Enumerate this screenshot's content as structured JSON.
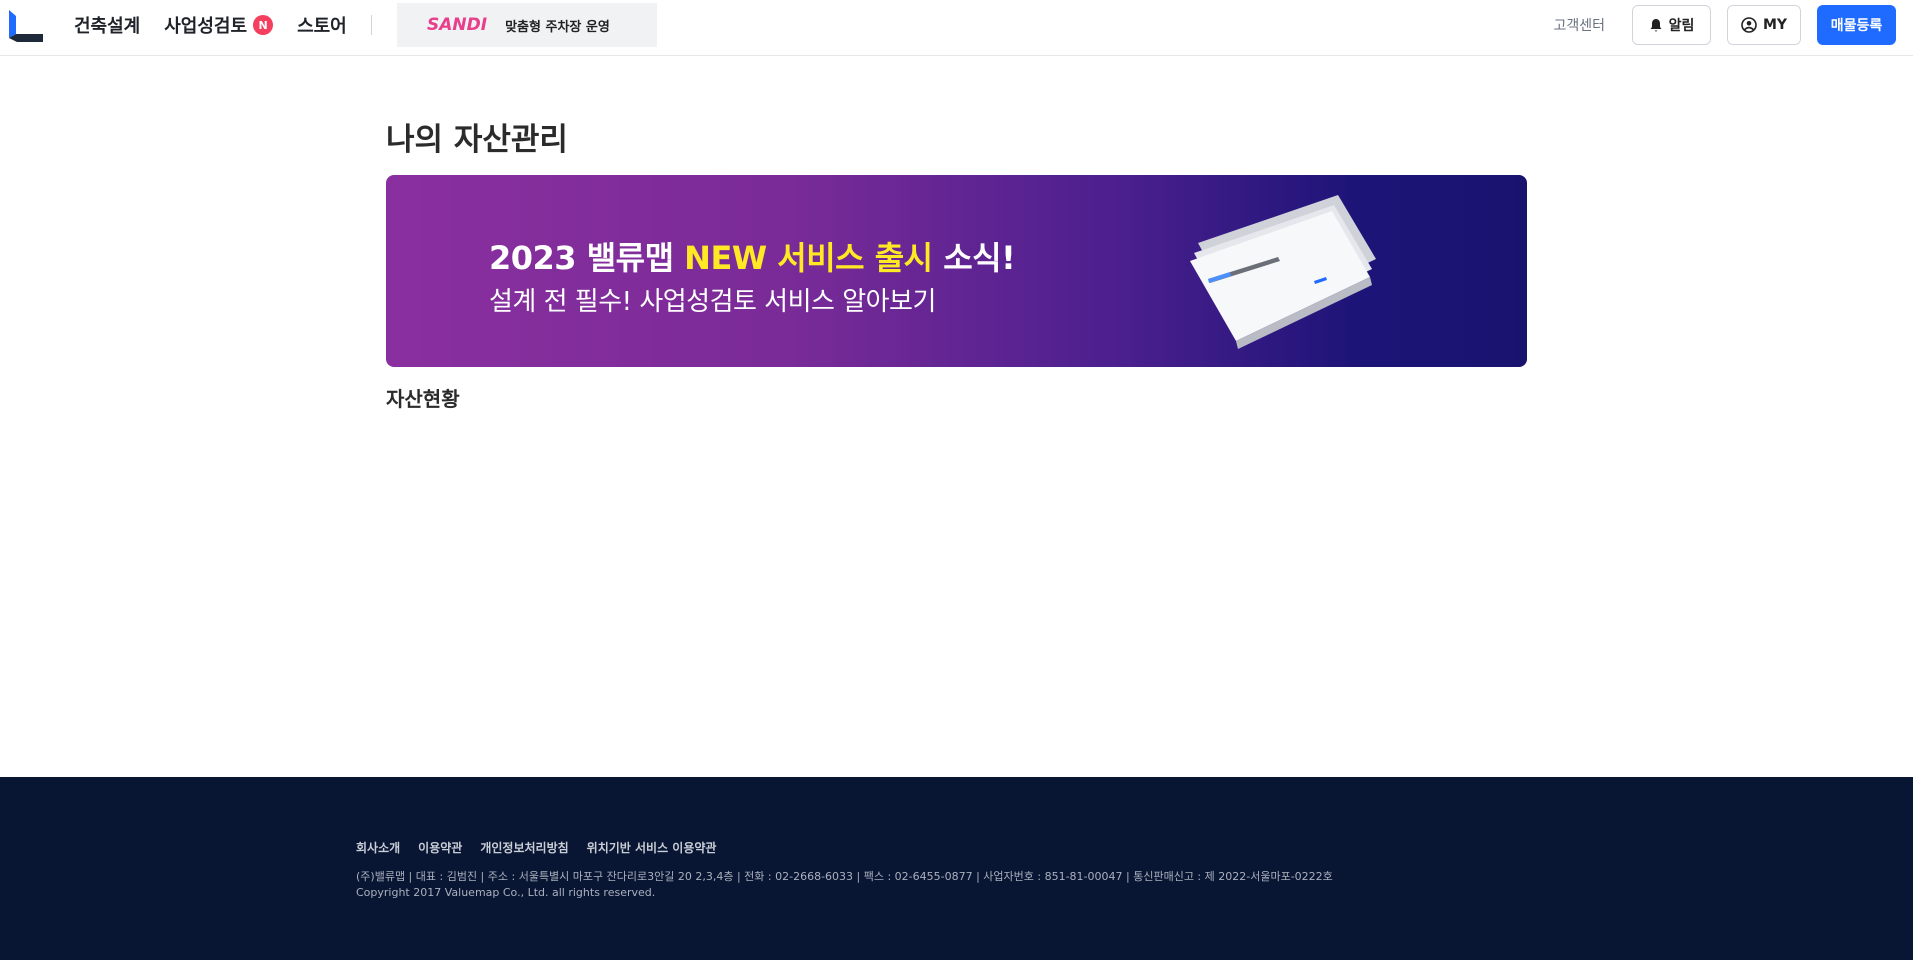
{
  "header": {
    "nav": [
      {
        "label": "건축설계"
      },
      {
        "label": "사업성검토",
        "badge": "N"
      },
      {
        "label": "스토어"
      }
    ],
    "sandi": {
      "logo": "SANDI",
      "text": "맞춤형 주차장 운영"
    },
    "customer_center": "고객센터",
    "alarm_label": "알림",
    "my_label": "MY",
    "register_label": "매물등록"
  },
  "main": {
    "page_title": "나의 자산관리",
    "banner": {
      "line1_prefix": "2023 밸류맵",
      "line1_highlight": "NEW 서비스 출시",
      "line1_suffix": "소식!",
      "line2": "설계 전 필수! 사업성검토 서비스 알아보기"
    },
    "section_title": "자산현황"
  },
  "footer": {
    "links": [
      "회사소개",
      "이용약관",
      "개인정보처리방침",
      "위치기반 서비스 이용약관"
    ],
    "info": "(주)밸류맵  |  대표 : 김범진  |  주소 : 서울특별시 마포구 잔다리로3안길 20 2,3,4층  |  전화 : 02-2668-6033  |  팩스 : 02-6455-0877  |  사업자번호 : 851-81-00047  |  통신판매신고 : 제 2022-서울마포-0222호",
    "copyright": "Copyright 2017 Valuemap Co., Ltd. all rights reserved."
  },
  "colors": {
    "primary": "#1f6bff",
    "badge": "#f43f5e",
    "banner_highlight": "#ffe924",
    "footer_bg": "#081633"
  }
}
